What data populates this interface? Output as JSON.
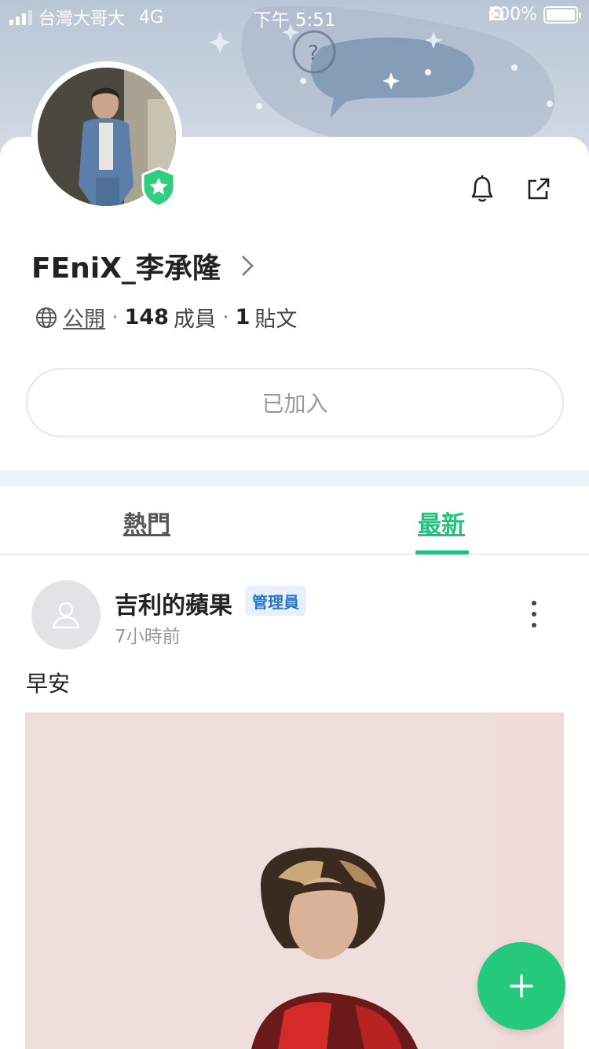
{
  "status_bar": {
    "carrier": "台灣大哥大",
    "network": "4G",
    "time": "下午 5:51",
    "battery": "100%"
  },
  "community": {
    "name": "FEniX_李承隆",
    "privacy": "公開",
    "members_count": "148",
    "members_label": "成員",
    "posts_count": "1",
    "posts_label": "貼文",
    "joined_label": "已加入"
  },
  "tabs": [
    {
      "label": "熱門",
      "active": false
    },
    {
      "label": "最新",
      "active": true
    }
  ],
  "post": {
    "author": "吉利的蘋果",
    "role": "管理員",
    "time": "7小時前",
    "text": "早安"
  },
  "colors": {
    "accent": "#1fc37a",
    "fab": "#25c97b",
    "role_bg": "#e6f1fb",
    "role_text": "#2b78c7"
  },
  "icons": {
    "bell": "bell-icon",
    "share": "share-icon",
    "globe": "globe-icon",
    "chevron": "chevron-right-icon",
    "more": "more-vertical-icon",
    "add": "plus-icon",
    "badge": "star-shield-icon"
  }
}
